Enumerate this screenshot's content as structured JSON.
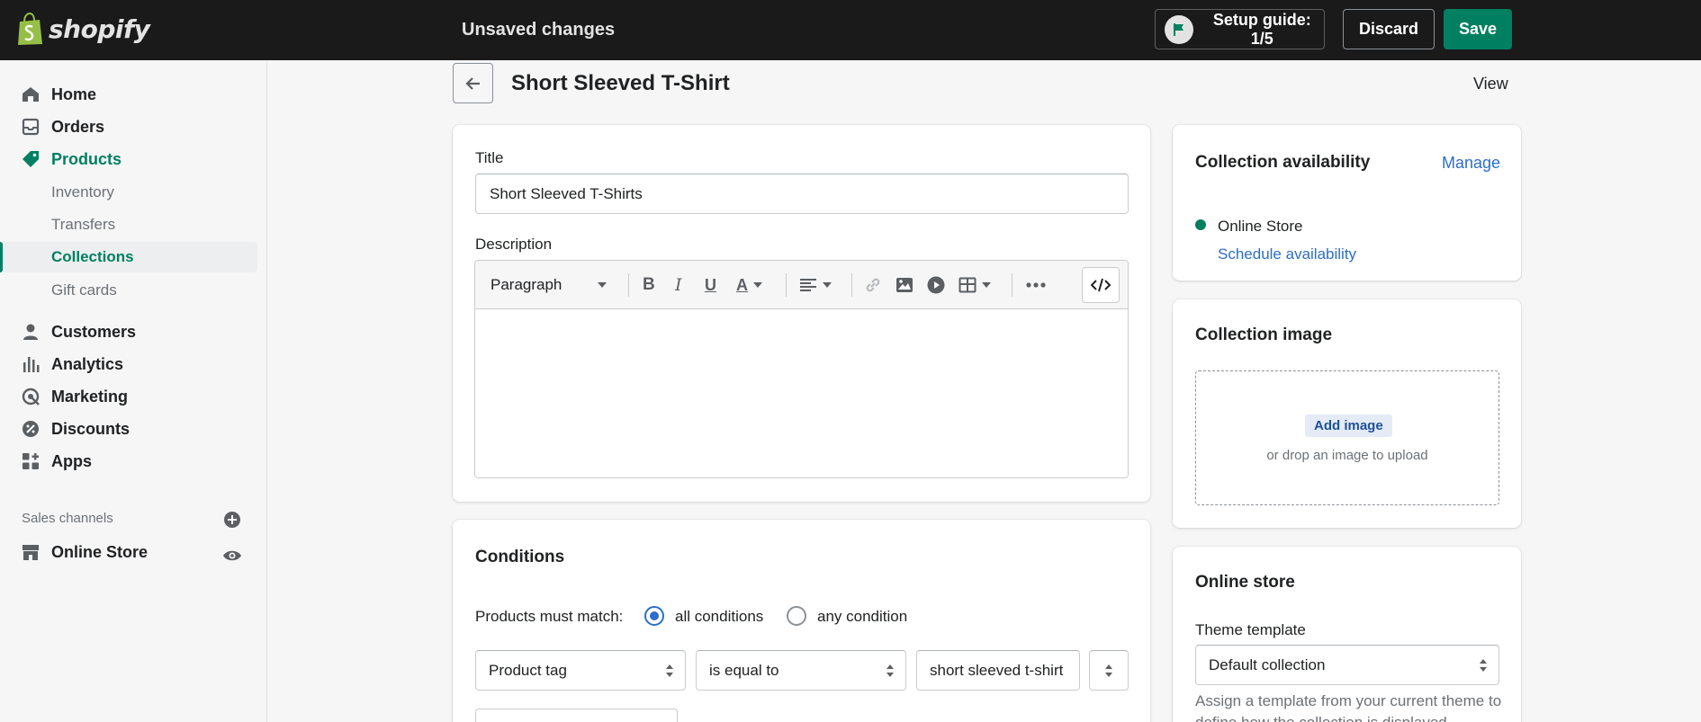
{
  "app": {
    "brand": "shopify",
    "status": "Unsaved changes",
    "setup_guide": "Setup guide: 1/5",
    "discard": "Discard",
    "save": "Save"
  },
  "sidebar": {
    "items": [
      {
        "label": "Home",
        "icon": "home-icon"
      },
      {
        "label": "Orders",
        "icon": "orders-icon"
      },
      {
        "label": "Products",
        "icon": "tag-icon"
      }
    ],
    "sub_items": [
      "Inventory",
      "Transfers",
      "Collections",
      "Gift cards"
    ],
    "more_items": [
      {
        "label": "Customers",
        "icon": "person-icon"
      },
      {
        "label": "Analytics",
        "icon": "bar-chart-icon"
      },
      {
        "label": "Marketing",
        "icon": "target-icon"
      },
      {
        "label": "Discounts",
        "icon": "discount-icon"
      },
      {
        "label": "Apps",
        "icon": "apps-icon"
      }
    ],
    "sales_channels_label": "Sales channels",
    "online_store": "Online Store"
  },
  "page": {
    "title": "Short Sleeved T-Shirt",
    "view": "View"
  },
  "details": {
    "title_label": "Title",
    "title_value": "Short Sleeved T-Shirts",
    "description_label": "Description",
    "paragraph": "Paragraph"
  },
  "conditions": {
    "heading": "Conditions",
    "match_label": "Products must match:",
    "option_all": "all conditions",
    "option_any": "any condition",
    "field": "Product tag",
    "operator": "is equal to",
    "value": "short sleeved t-shirt"
  },
  "availability": {
    "heading": "Collection availability",
    "manage": "Manage",
    "channel": "Online Store",
    "schedule": "Schedule availability",
    "dot_color": "#007f5f"
  },
  "image": {
    "heading": "Collection image",
    "add": "Add image",
    "hint": "or drop an image to upload"
  },
  "online_store": {
    "heading": "Online store",
    "theme_label": "Theme template",
    "theme_value": "Default collection",
    "help": "Assign a template from your current theme to define how the collection is displayed."
  },
  "colors": {
    "accent": "#008060",
    "link": "#2c6ecb",
    "topbar": "#1a1a1a"
  }
}
